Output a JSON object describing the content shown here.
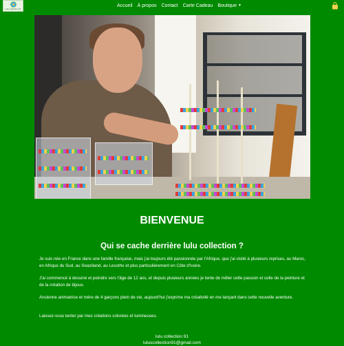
{
  "navbar": {
    "logo_text": "Lulu collection 91",
    "links": [
      "Accueil",
      "À propos",
      "Contact",
      "Carte Cadeau",
      "Boutique"
    ],
    "cart_icon": "shopping-bag-icon"
  },
  "hero": {
    "alt": "photo"
  },
  "content": {
    "title": "BIENVENUE",
    "subtitle": "Qui se cache derrière lulu collection ?",
    "paragraphs": [
      "Je suis née en France dans une famille française, mais j'ai toujours été passionnée par l'Afrique, que j'ai visité à plusieurs reprises, au Maroc, en Afrique du Sud, au Swaziland, au Lesotho et plus particulièrement en Côte d'Ivoire.",
      "J'ai commencé à dessiné et peindre vers l'âge de 12 ans, et depuis plusieurs années je tente de mêler cette passion et celle de la peinture et de la création de bijoux.",
      "Ancienne animatrice et mère de 4 garçons plein de vie, aujourd'hui j'exprime ma créativité en me lançant dans cette nouvelle aventure.",
      "Laissez-vous tenter par mes créations colorées et lumineuses."
    ]
  },
  "footer": {
    "line1": "lulu collection 91",
    "line2": "luluscollection91@gmail.com"
  },
  "colors": {
    "background": "#008a00",
    "text": "#ffffff"
  }
}
